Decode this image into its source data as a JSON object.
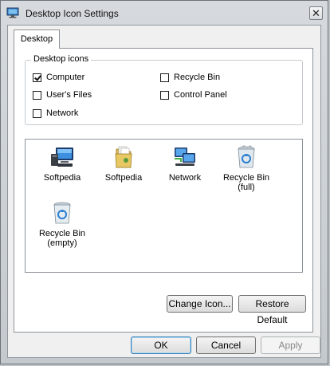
{
  "window": {
    "title": "Desktop Icon Settings",
    "close_label": "✕"
  },
  "tabs": [
    {
      "label": "Desktop"
    }
  ],
  "group": {
    "legend": "Desktop icons",
    "checkboxes": [
      {
        "label": "Computer",
        "checked": true
      },
      {
        "label": "User's Files",
        "checked": false
      },
      {
        "label": "Network",
        "checked": false
      },
      {
        "label": "Recycle Bin",
        "checked": false
      },
      {
        "label": "Control Panel",
        "checked": false
      }
    ]
  },
  "icon_list": [
    {
      "label": "Softpedia",
      "icon": "computer-icon"
    },
    {
      "label": "Softpedia",
      "icon": "user-files-icon"
    },
    {
      "label": "Network",
      "icon": "network-icon"
    },
    {
      "label": "Recycle Bin (full)",
      "icon": "recycle-bin-full-icon"
    },
    {
      "label": "Recycle Bin (empty)",
      "icon": "recycle-bin-empty-icon"
    }
  ],
  "buttons": {
    "change_icon": "Change Icon...",
    "restore_default": "Restore Default",
    "ok": "OK",
    "cancel": "Cancel",
    "apply": "Apply"
  }
}
